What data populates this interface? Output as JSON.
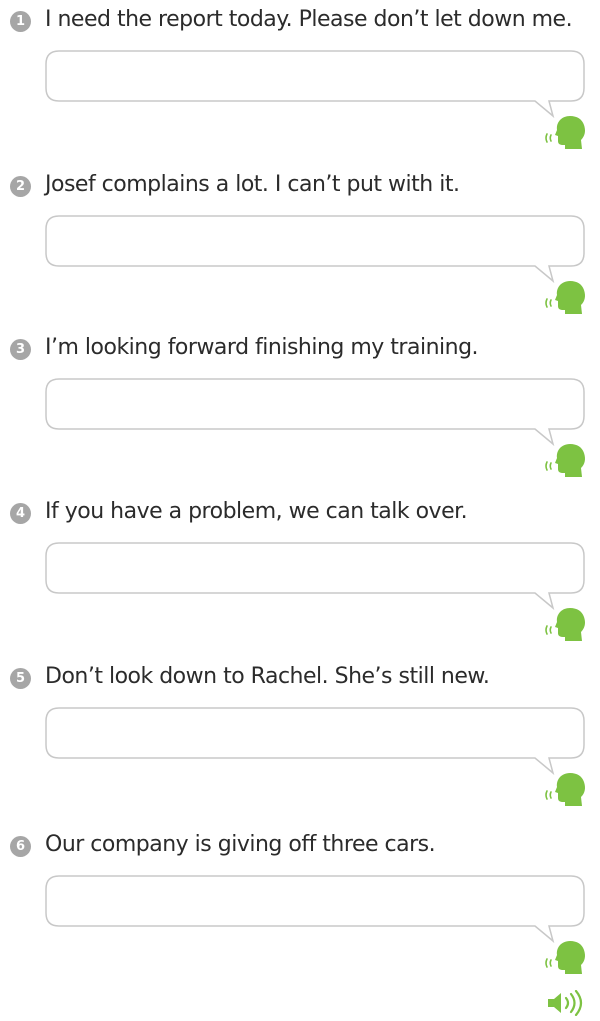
{
  "exercises": [
    {
      "number": "1",
      "sentence": "I need the report today. Please don’t let down me.",
      "answer": ""
    },
    {
      "number": "2",
      "sentence": "Josef complains a lot. I can’t put with it.",
      "answer": ""
    },
    {
      "number": "3",
      "sentence": "I’m looking forward finishing my training.",
      "answer": ""
    },
    {
      "number": "4",
      "sentence": "If you have a problem, we can talk over.",
      "answer": ""
    },
    {
      "number": "5",
      "sentence": "Don’t look down to Rachel. She’s still new.",
      "answer": ""
    },
    {
      "number": "6",
      "sentence": "Our company is giving off three cars.",
      "answer": ""
    }
  ],
  "icons": {
    "speak": "speaking-head-icon",
    "audio": "speaker-volume-icon"
  },
  "colors": {
    "accent_green": "#7dc242",
    "number_badge": "#a6a6a6",
    "bubble_border": "#c8c8c8"
  }
}
